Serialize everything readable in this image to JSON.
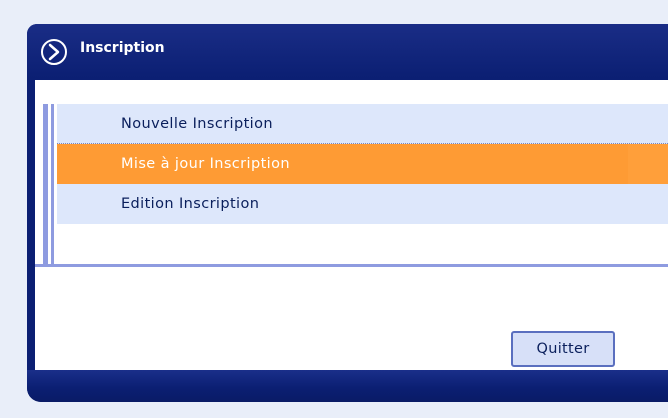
{
  "header": {
    "title": "Inscription",
    "icon": "chevron-right-icon"
  },
  "menu": {
    "items": [
      {
        "label": "Nouvelle Inscription",
        "active": false
      },
      {
        "label": "Mise à jour Inscription",
        "active": true
      },
      {
        "label": "Edition Inscription",
        "active": false
      }
    ]
  },
  "actions": {
    "quit_label": "Quitter"
  },
  "colors": {
    "panel": "#0b1f73",
    "menu_item_bg": "#dde7fb",
    "menu_item_active": "#fe9b34",
    "accent_line": "#8e9be0",
    "page_bg": "#e9eef9"
  }
}
